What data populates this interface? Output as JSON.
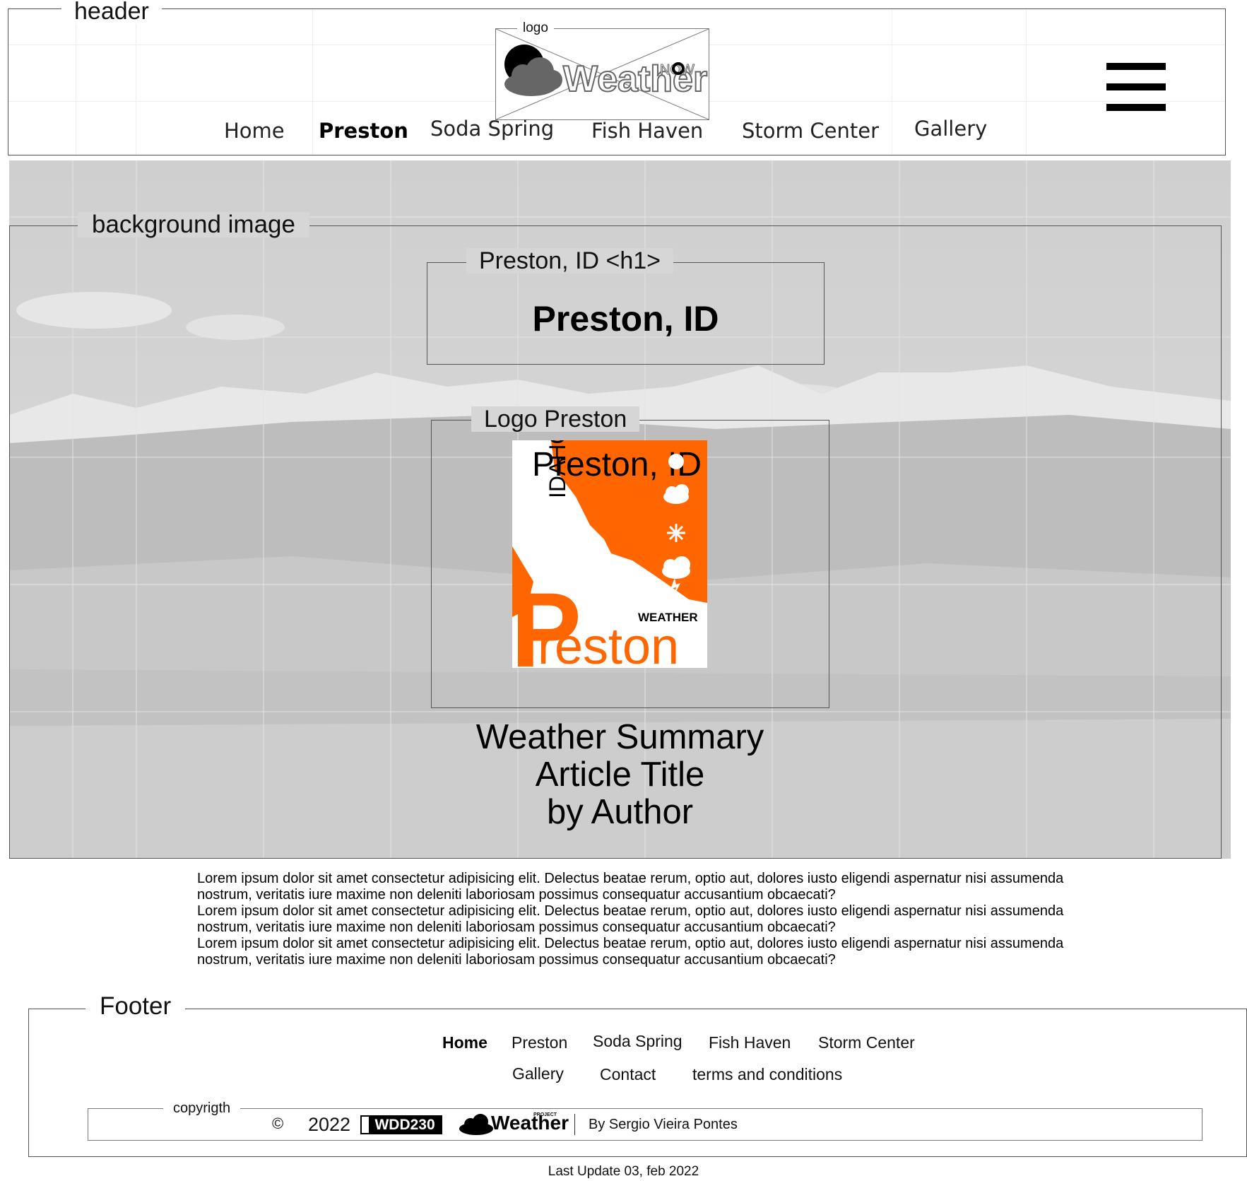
{
  "header": {
    "legend": "header",
    "logo_legend": "logo",
    "logo_text": "Weather",
    "logo_sup": "NOW",
    "nav": [
      "Home",
      "Preston",
      "Soda Spring",
      "Fish Haven",
      "Storm Center",
      "Gallery"
    ],
    "active_nav": "Preston"
  },
  "hero": {
    "bg_legend": "background image",
    "h1_legend": "Preston, ID <h1>",
    "h1": "Preston, ID",
    "logo_legend": "Logo Preston",
    "logo": {
      "title": "Preston, ID",
      "state": "IDAHO",
      "weather": "WEATHER",
      "big_letter": "P",
      "name_rest": "reston",
      "accent": "#ff6600"
    },
    "summary": [
      "Weather Summary",
      "Article Title",
      "by Author"
    ]
  },
  "body_text": [
    "Lorem ipsum dolor sit amet consectetur adipisicing elit. Delectus beatae rerum, optio aut, dolores iusto eligendi aspernatur nisi assumenda nostrum, veritatis iure maxime non deleniti laboriosam possimus consequatur accusantium obcaecati?",
    "Lorem ipsum dolor sit amet consectetur adipisicing elit. Delectus beatae rerum, optio aut, dolores iusto eligendi aspernatur nisi assumenda nostrum, veritatis iure maxime non deleniti laboriosam possimus consequatur accusantium obcaecati?",
    "Lorem ipsum dolor sit amet consectetur adipisicing elit. Delectus beatae rerum, optio aut, dolores iusto eligendi aspernatur nisi assumenda nostrum, veritatis iure maxime non deleniti laboriosam possimus consequatur accusantium obcaecati?"
  ],
  "footer": {
    "legend": "Footer",
    "nav_row1": [
      "Home",
      "Preston",
      "Soda Spring",
      "Fish Haven",
      "Storm Center"
    ],
    "nav_row2": [
      "Gallery",
      "Contact",
      "terms and conditions"
    ],
    "active_nav": "Home",
    "copyright_legend": "copyrigth",
    "copyright_symbol": "©",
    "year": "2022",
    "badge": "WDD230",
    "brand": "Weather",
    "brand_sup": "PROJECT",
    "author": "By Sergio Vieira Pontes",
    "last_update": "Last Update 03, feb 2022"
  },
  "icons": [
    "hamburger-menu-icon",
    "sun-cloud-icon",
    "snowflake-icon",
    "rain-cloud-icon",
    "storm-cloud-icon",
    "cloud-icon"
  ]
}
